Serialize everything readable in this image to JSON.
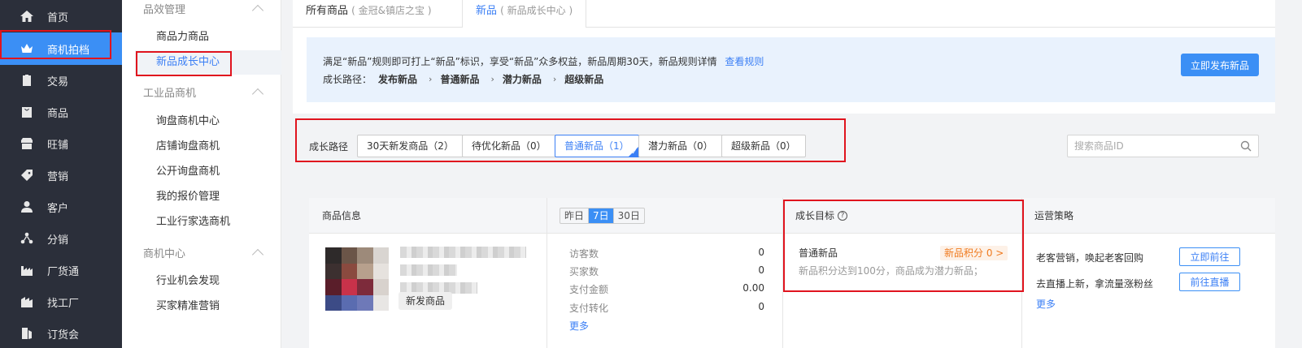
{
  "nav": {
    "items": [
      {
        "label": "首页",
        "icon": "home-icon"
      },
      {
        "label": "商机拍档",
        "icon": "crown-icon",
        "active": true
      },
      {
        "label": "交易",
        "icon": "clipboard-icon"
      },
      {
        "label": "商品",
        "icon": "bag-icon"
      },
      {
        "label": "旺铺",
        "icon": "shop-icon"
      },
      {
        "label": "营销",
        "icon": "tag-icon"
      },
      {
        "label": "客户",
        "icon": "user-icon"
      },
      {
        "label": "分销",
        "icon": "share-icon"
      },
      {
        "label": "厂货通",
        "icon": "factory-icon"
      },
      {
        "label": "找工厂",
        "icon": "building-icon"
      },
      {
        "label": "订货会",
        "icon": "door-icon"
      }
    ]
  },
  "submenu": {
    "groups": [
      {
        "title": "品效管理",
        "items": [
          "商品力商品",
          "新品成长中心"
        ]
      },
      {
        "title": "工业品商机",
        "items": [
          "询盘商机中心",
          "店铺询盘商机",
          "公开询盘商机",
          "我的报价管理",
          "工业行家选商机"
        ]
      },
      {
        "title": "商机中心",
        "items": [
          "行业机会发现",
          "买家精准营销"
        ]
      }
    ],
    "active_item": "新品成长中心"
  },
  "tabs": [
    {
      "label": "所有商品",
      "sub": "( 金冠&镇店之宝 )"
    },
    {
      "label": "新品",
      "sub": "( 新品成长中心 )",
      "active": true
    }
  ],
  "notice": {
    "line1": "满足“新品”规则即可打上“新品”标识，享受“新品”众多权益，新品周期30天，新品规则详情",
    "link": "查看规则",
    "path_label": "成长路径：",
    "path_steps": [
      "发布新品",
      "普通新品",
      "潜力新品",
      "超级新品"
    ],
    "path_arrow": "›",
    "publish_button": "立即发布新品"
  },
  "filter": {
    "label": "成长路径",
    "chips": [
      "30天新发商品（2）",
      "待优化新品（0）",
      "普通新品（1）",
      "潜力新品（0）",
      "超级新品（0）"
    ],
    "active_index": 2,
    "search_placeholder": "搜索商品ID"
  },
  "table": {
    "headers": {
      "product": "商品信息",
      "range": [
        "昨日",
        "7日",
        "30日"
      ],
      "range_selected": "7日",
      "goal": "成长目标",
      "goal_help": "?",
      "strategy": "运营策略"
    },
    "row": {
      "tag": "新发商品",
      "metrics": [
        {
          "label": "访客数",
          "value": "0"
        },
        {
          "label": "买家数",
          "value": "0"
        },
        {
          "label": "支付金额",
          "value": "0.00"
        },
        {
          "label": "支付转化",
          "value": "0"
        }
      ],
      "metrics_more": "更多",
      "goal_name": "普通新品",
      "goal_badge": "新品积分 0 >",
      "goal_desc": "新品积分达到100分，商品成为潜力新品；",
      "strategies": [
        {
          "text": "老客营销，唤起老客回购",
          "button": "立即前往"
        },
        {
          "text": "去直播上新，拿流量涨粉丝",
          "button": "前往直播"
        }
      ],
      "strategy_more": "更多"
    }
  },
  "colors": {
    "accent": "#3b8ff5",
    "nav_bg": "#2b2f3a",
    "annotation": "#e0141e",
    "badge": "#f07a1e"
  }
}
